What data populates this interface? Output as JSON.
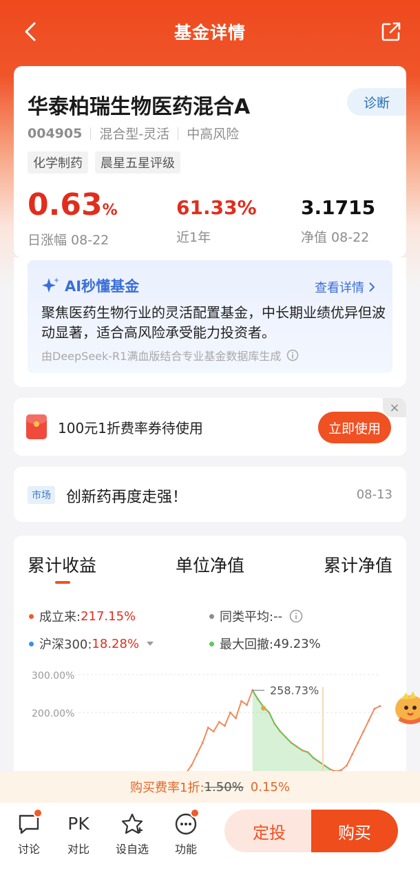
{
  "header": {
    "title": "基金详情"
  },
  "fund": {
    "name": "华泰柏瑞生物医药混合A",
    "diagnose_label": "诊断",
    "code": "004905",
    "type": "混合型-灵活",
    "risk": "中高风险",
    "tags": [
      "化学制药",
      "晨星五星评级"
    ],
    "daily_change_value": "0.63",
    "daily_change_unit": "%",
    "daily_change_label": "日涨幅 08-22",
    "year_return_value": "61.33%",
    "year_return_label": "近1年",
    "nav_value": "3.1715",
    "nav_label": "净值 08-22"
  },
  "ai": {
    "title": "AI秒懂基金",
    "more_label": "查看详情",
    "summary": "聚焦医药生物行业的灵活配置基金，中长期业绩优异但波动显著，适合高风险承受能力投资者。",
    "source": "由DeepSeek-R1满血版结合专业基金数据库生成"
  },
  "coupon": {
    "text": "100元1折费率券待使用",
    "button": "立即使用",
    "close": "×"
  },
  "news": {
    "badge": "市场",
    "text": "创新药再度走强！",
    "date": "08-13"
  },
  "chart_tabs": [
    "累计收益",
    "单位净值",
    "累计净值"
  ],
  "legend": {
    "since_inception_label": "成立来:",
    "since_inception_value": "217.15%",
    "peer_avg_label": "同类平均:",
    "peer_avg_value": "--",
    "hs300_label": "沪深300:",
    "hs300_value": "18.28%",
    "max_drawdown_label": "最大回撤:",
    "max_drawdown_value": "49.23%"
  },
  "colors": {
    "accent": "#ef5123",
    "up_red": "#e02e1e",
    "ai_blue": "#3a6fd8",
    "fund_line": "#f08a5d",
    "drawdown_green": "#5cc85a",
    "hs300_blue": "#3a8ee6"
  },
  "chart_data": {
    "type": "line",
    "ytick_labels": [
      "300.00%",
      "200.00%"
    ],
    "ylim": [
      0,
      300
    ],
    "peak_label": "258.73%",
    "series": [
      {
        "name": "成立来",
        "values": [
          40,
          60,
          90,
          120,
          160,
          150,
          175,
          165,
          200,
          185,
          230,
          220,
          258.73,
          235,
          215,
          200,
          170,
          150,
          135,
          120,
          110,
          100,
          95,
          80,
          70,
          60,
          50,
          45,
          48,
          60,
          90,
          120,
          150,
          180,
          210,
          217.15
        ]
      }
    ],
    "grid": true
  },
  "promo": {
    "text": "购买费率1折:",
    "old_rate": "1.50%",
    "new_rate": "0.15%"
  },
  "bottom_nav": [
    {
      "icon": "chat-icon",
      "label": "讨论"
    },
    {
      "icon": "pk-icon",
      "label": "对比",
      "glyph": "PK"
    },
    {
      "icon": "star-add-icon",
      "label": "设自选"
    },
    {
      "icon": "more-icon",
      "label": "功能"
    }
  ],
  "actions": {
    "dingtou": "定投",
    "buy": "购买"
  }
}
